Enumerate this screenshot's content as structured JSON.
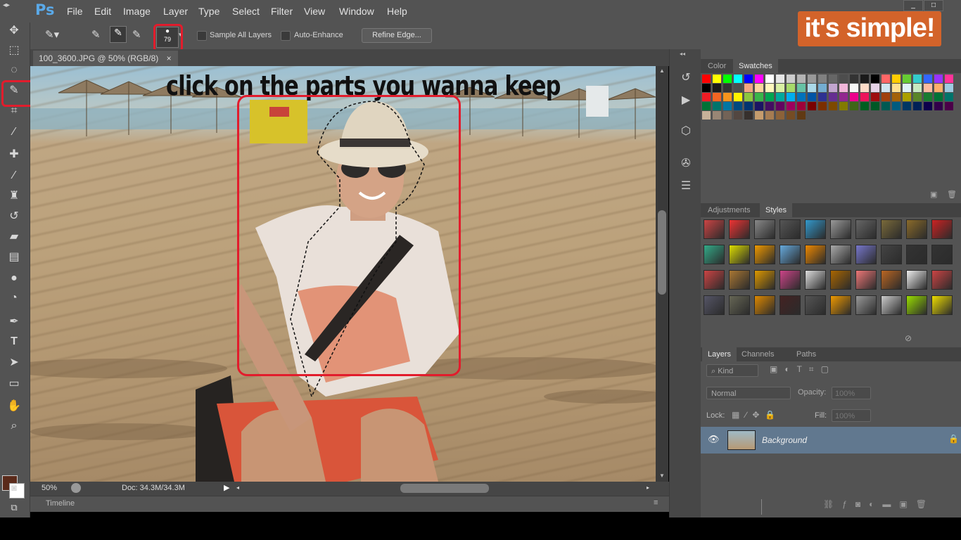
{
  "app": {
    "logo_text": "Ps",
    "menus": [
      "File",
      "Edit",
      "Image",
      "Layer",
      "Type",
      "Select",
      "Filter",
      "View",
      "Window",
      "Help"
    ],
    "window_buttons": [
      "_",
      "□"
    ]
  },
  "options_bar": {
    "brush_size": "79",
    "sample_all_layers": "Sample All Layers",
    "auto_enhance": "Auto-Enhance",
    "refine_edge": "Refine Edge..."
  },
  "overlay": {
    "logo_text": "it's simple!",
    "caption": "click on the parts you wanna keep"
  },
  "document": {
    "tab_title": "100_3600.JPG @ 50% (RGB/8)",
    "tab_close": "×",
    "zoom": "50%",
    "doc_info": "Doc: 34.3M/34.3M"
  },
  "timeline": {
    "label": "Timeline"
  },
  "panels": {
    "color_tabs": [
      "Color",
      "Swatches"
    ],
    "style_tabs": [
      "Adjustments",
      "Styles"
    ],
    "layer_tabs": [
      "Layers",
      "Channels",
      "Paths"
    ],
    "kind_label": "Kind",
    "blend_mode": "Normal",
    "opacity_label": "Opacity:",
    "opacity_value": "100%",
    "lock_label": "Lock:",
    "fill_label": "Fill:",
    "fill_value": "100%",
    "layer_name": "Background"
  },
  "colors": {
    "ui_bg": "#535353",
    "highlight": "#e21c2c",
    "logo_bg": "#d3632a",
    "selected_layer": "#61788f",
    "foreground": "#5a2a1a",
    "background": "#ffffff"
  },
  "icons": [
    "move-icon",
    "marquee-icon",
    "lasso-icon",
    "quick-selection-icon",
    "crop-icon",
    "eyedropper-icon",
    "healing-brush-icon",
    "brush-icon",
    "clone-stamp-icon",
    "history-brush-icon",
    "eraser-icon",
    "gradient-icon",
    "blur-icon",
    "dodge-icon",
    "pen-icon",
    "type-icon",
    "path-selection-icon",
    "shape-icon",
    "hand-icon",
    "zoom-icon",
    "eye-icon",
    "lock-icon"
  ]
}
